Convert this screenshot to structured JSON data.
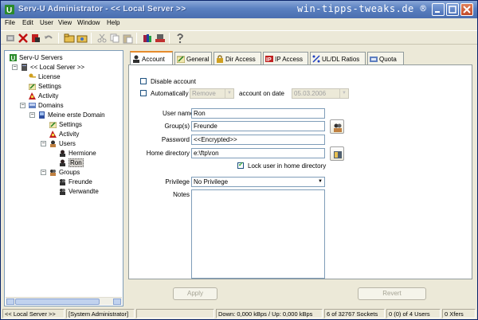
{
  "window": {
    "title": "Serv-U Administrator - << Local Server >>",
    "watermark": "win-tipps-tweaks.de ®"
  },
  "menu": [
    "File",
    "Edit",
    "User",
    "View",
    "Window",
    "Help"
  ],
  "toolbar_icons": [
    "connect-icon",
    "delete-icon",
    "disconnect-icon",
    "undo-icon",
    "open-folder-icon",
    "open-folder2-icon",
    "cut-icon",
    "copy-icon",
    "paste-icon",
    "books-icon",
    "server-icon",
    "help-icon"
  ],
  "tree": {
    "root": "Serv-U Servers",
    "server": "<< Local Server >>",
    "license": "License",
    "settings": "Settings",
    "activity": "Activity",
    "domains": "Domains",
    "domain": "Meine erste Domain",
    "d_settings": "Settings",
    "d_activity": "Activity",
    "users": "Users",
    "user1": "Hermione",
    "user2": "Ron",
    "groups": "Groups",
    "group1": "Freunde",
    "group2": "Verwandte"
  },
  "tabs": [
    {
      "label": "Account",
      "icon": "user-icon"
    },
    {
      "label": "General",
      "icon": "pencil-icon"
    },
    {
      "label": "Dir Access",
      "icon": "lock-icon"
    },
    {
      "label": "IP Access",
      "icon": "ip-icon"
    },
    {
      "label": "UL/DL Ratios",
      "icon": "ratio-icon"
    },
    {
      "label": "Quota",
      "icon": "quota-icon"
    }
  ],
  "form": {
    "disable_account": "Disable account",
    "automatically": "Automatically",
    "auto_action": "Remove",
    "account_on_date": "account on date",
    "date": "05.03.2006",
    "user_name_label": "User name",
    "user_name": "Ron",
    "groups_label": "Group(s)",
    "groups": "Freunde",
    "password_label": "Password",
    "password": "<<Encrypted>>",
    "home_dir_label": "Home directory",
    "home_dir": "e:\\ftp\\ron",
    "lock_home": "Lock user in home directory",
    "privilege_label": "Privilege",
    "privilege": "No Privilege",
    "notes_label": "Notes",
    "notes": ""
  },
  "buttons": {
    "apply": "Apply",
    "revert": "Revert"
  },
  "status": {
    "server": "<< Local Server >>",
    "role": "[System Administrator]",
    "rate": "Down: 0,000 kBps / Up: 0,000 kBps",
    "sockets": "6 of 32767 Sockets",
    "users": "0 (0) of 4 Users",
    "xfers": "0 Xfers"
  }
}
